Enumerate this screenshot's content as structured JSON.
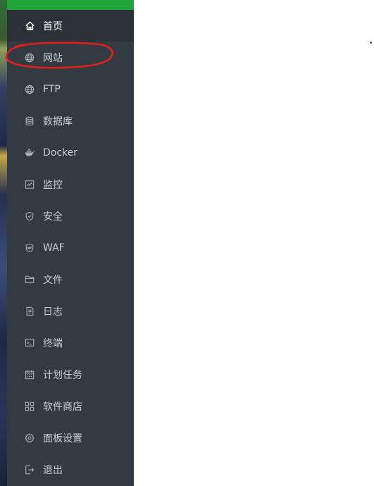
{
  "sidebar": {
    "accent_color": "#20a53a",
    "background_color": "#333a42",
    "items": [
      {
        "label": "首页",
        "icon": "home-icon",
        "active": true
      },
      {
        "label": "网站",
        "icon": "globe-icon",
        "active": false
      },
      {
        "label": "FTP",
        "icon": "globe-icon",
        "active": false
      },
      {
        "label": "数据库",
        "icon": "database-icon",
        "active": false
      },
      {
        "label": "Docker",
        "icon": "docker-icon",
        "active": false
      },
      {
        "label": "监控",
        "icon": "monitor-chart-icon",
        "active": false
      },
      {
        "label": "安全",
        "icon": "shield-icon",
        "active": false
      },
      {
        "label": "WAF",
        "icon": "waf-shield-icon",
        "active": false
      },
      {
        "label": "文件",
        "icon": "folder-icon",
        "active": false
      },
      {
        "label": "日志",
        "icon": "log-document-icon",
        "active": false
      },
      {
        "label": "终端",
        "icon": "terminal-icon",
        "active": false
      },
      {
        "label": "计划任务",
        "icon": "calendar-icon",
        "active": false
      },
      {
        "label": "软件商店",
        "icon": "apps-grid-icon",
        "active": false
      },
      {
        "label": "面板设置",
        "icon": "gear-icon",
        "active": false
      },
      {
        "label": "退出",
        "icon": "logout-icon",
        "active": false
      }
    ]
  },
  "annotation": {
    "color": "#e0201f",
    "highlighted_item": "网站"
  }
}
